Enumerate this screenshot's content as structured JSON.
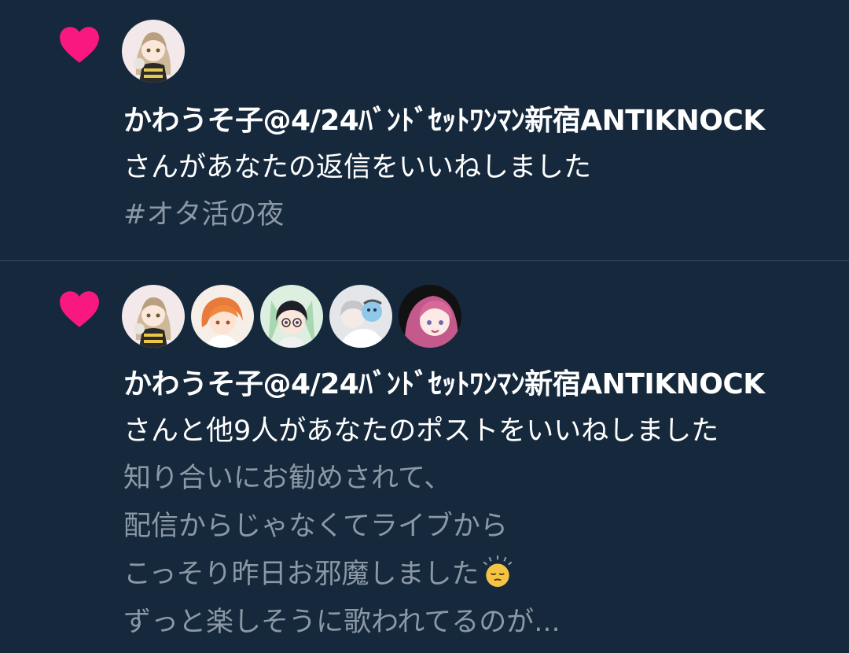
{
  "notifications": [
    {
      "type": "like",
      "user_name": "かわうそ子@4/24ﾊﾞﾝﾄﾞｾｯﾄﾜﾝﾏﾝ新宿ANTIKNOCK",
      "action": "さんがあなたの返信をいいねしました",
      "snippet_lines": [
        "#オタ活の夜"
      ],
      "avatars": [
        "avatar-user-1"
      ]
    },
    {
      "type": "like",
      "user_name": "かわうそ子@4/24ﾊﾞﾝﾄﾞｾｯﾄﾜﾝﾏﾝ新宿ANTIKNOCK",
      "action": "さんと他9人があなたのポストをいいねしました",
      "snippet_lines": [
        "知り合いにお勧めされて、",
        "配信からじゃなくてライブから",
        "こっそり昨日お邪魔しました",
        "ずっと楽しそうに歌われてるのが..."
      ],
      "snippet_emoji": "sleepy-face-emoji",
      "avatars": [
        "avatar-user-1",
        "avatar-user-2",
        "avatar-user-3",
        "avatar-user-4",
        "avatar-user-5"
      ]
    }
  ],
  "colors": {
    "background": "#15283c",
    "heart": "#f91880",
    "divider": "#3a4b5e",
    "primary_text": "#ffffff",
    "secondary_text": "#8b98a5"
  }
}
